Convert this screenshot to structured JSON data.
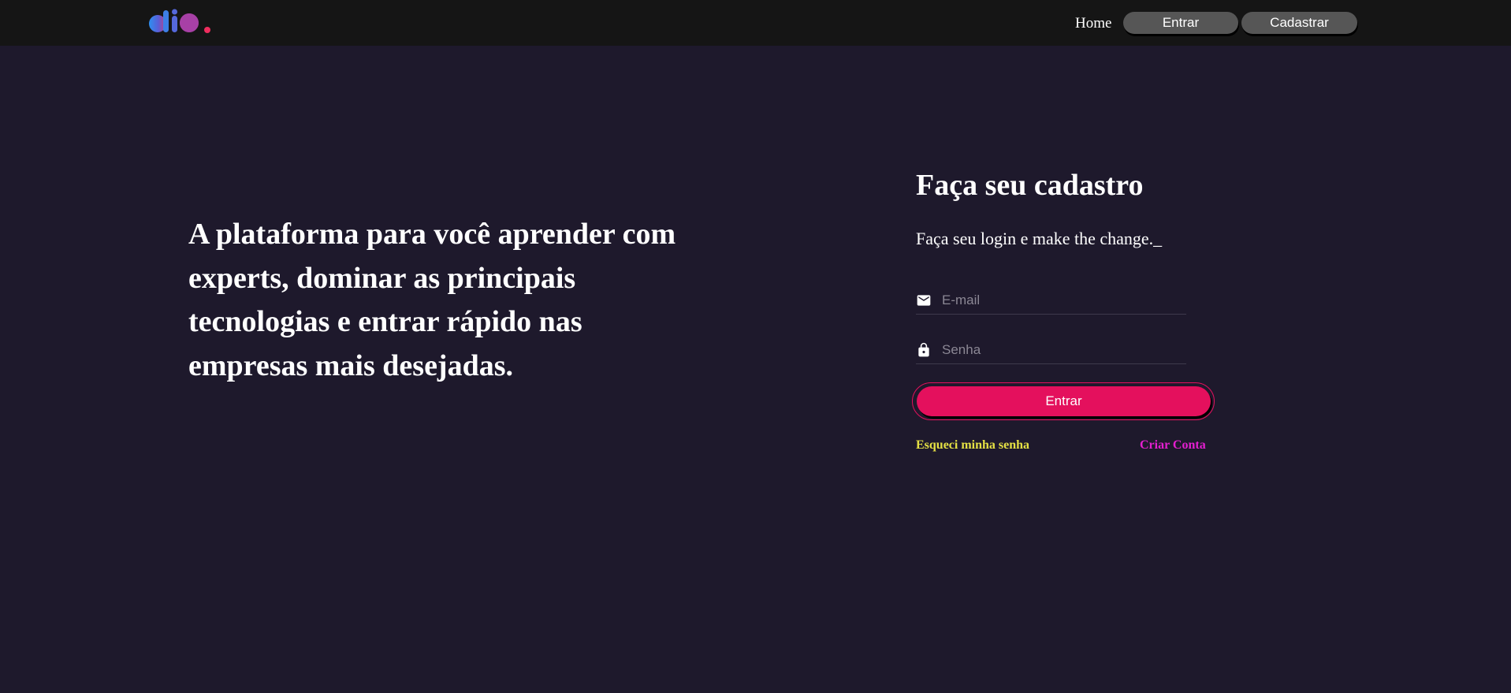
{
  "header": {
    "logo_icon": "dio-logo-icon",
    "nav": {
      "home_label": "Home",
      "entrar_label": "Entrar",
      "cadastrar_label": "Cadastrar"
    }
  },
  "hero": {
    "headline": "A plataforma para você aprender com experts, dominar as principais tecnologias e entrar rápido nas empresas mais desejadas."
  },
  "form": {
    "title": "Faça seu cadastro",
    "subtitle": "Faça seu login e make the change._",
    "email": {
      "placeholder": "E-mail",
      "value": "",
      "icon": "mail-icon"
    },
    "senha": {
      "placeholder": "Senha",
      "value": "",
      "icon": "lock-icon"
    },
    "submit_label": "Entrar",
    "forgot_label": "Esqueci minha senha",
    "create_label": "Criar Conta"
  },
  "colors": {
    "background": "#1e192c",
    "header": "#151515",
    "nav_button": "#565656",
    "primary": "#e4105d",
    "forgot_link": "#e5e044",
    "create_link": "#e41fd0"
  }
}
